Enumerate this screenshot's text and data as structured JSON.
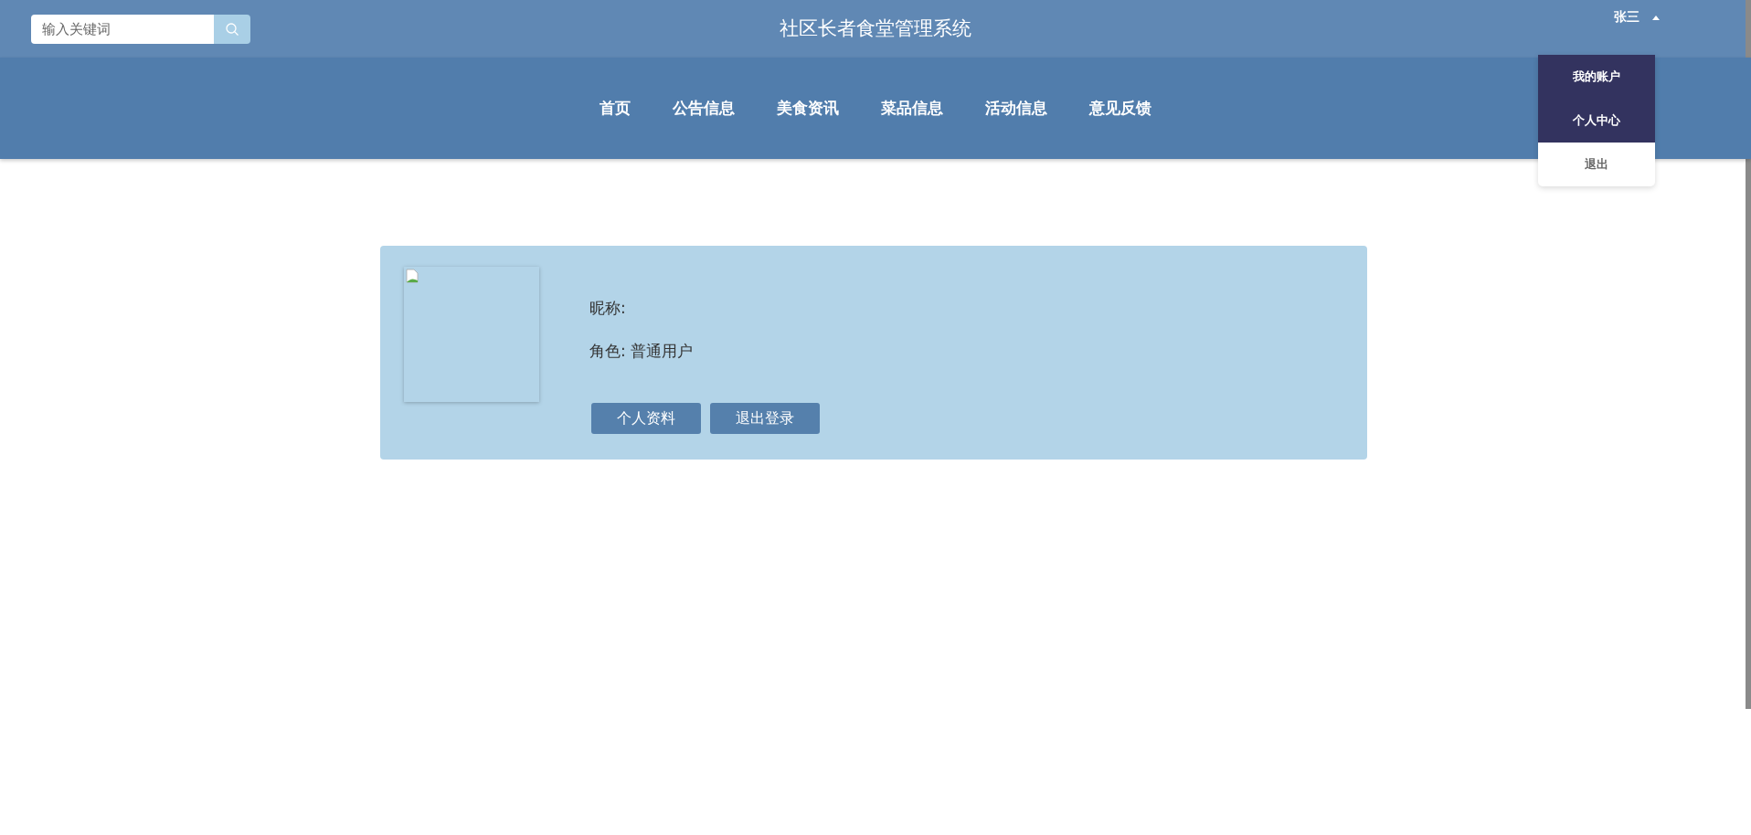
{
  "header": {
    "search": {
      "placeholder": "输入关键词"
    },
    "title": "社区长者食堂管理系统",
    "user": {
      "name": "张三",
      "expanded": true
    }
  },
  "user_menu": [
    {
      "label": "我的账户",
      "highlighted": true
    },
    {
      "label": "个人中心",
      "highlighted": true
    },
    {
      "label": "退出",
      "highlighted": false
    }
  ],
  "nav": [
    {
      "label": "首页"
    },
    {
      "label": "公告信息"
    },
    {
      "label": "美食资讯"
    },
    {
      "label": "菜品信息"
    },
    {
      "label": "活动信息"
    },
    {
      "label": "意见反馈"
    }
  ],
  "profile": {
    "nickname_label": "昵称:",
    "role": "角色: 普通用户",
    "buttons": [
      "个人资料",
      "退出登录"
    ]
  }
}
